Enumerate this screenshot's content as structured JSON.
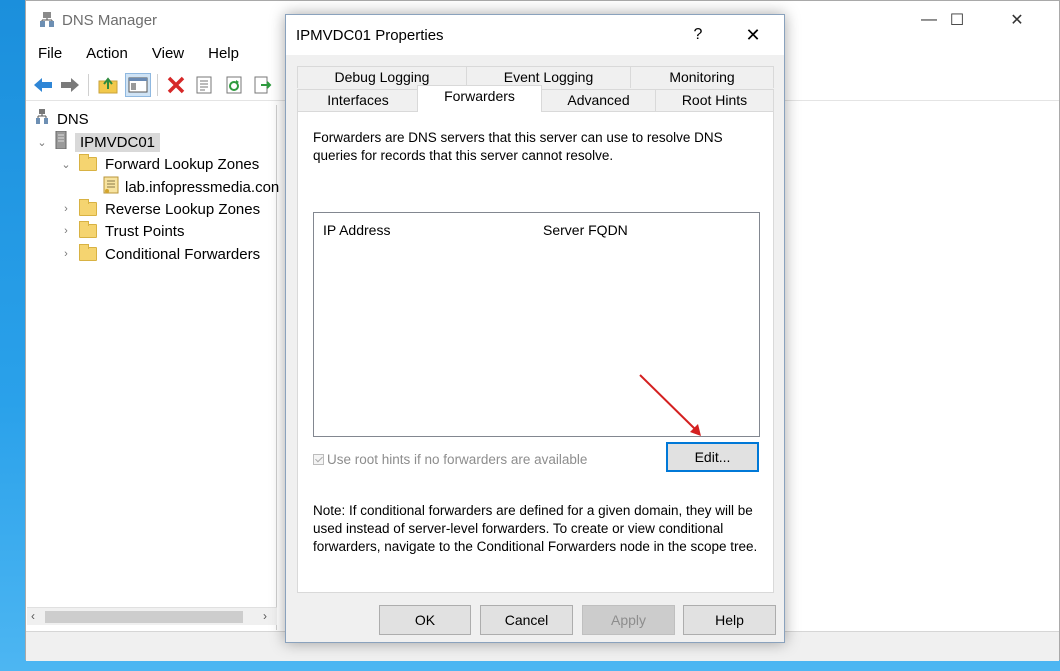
{
  "main_window": {
    "title": "DNS Manager",
    "controls": {
      "minimize": "—",
      "maximize": "☐",
      "close": "✕"
    }
  },
  "menu": [
    "File",
    "Action",
    "View",
    "Help"
  ],
  "toolbar_icons": [
    "back-icon",
    "forward-icon",
    "up-folder-icon",
    "show-hide-console-tree-icon",
    "delete-icon",
    "properties-icon",
    "refresh-icon",
    "export-list-icon"
  ],
  "tree": {
    "root": "DNS",
    "server": "IPMVDC01",
    "forward_lookup_zones": "Forward Lookup Zones",
    "zone": "lab.infopressmedia.con",
    "reverse_lookup_zones": "Reverse Lookup Zones",
    "trust_points": "Trust Points",
    "conditional_forwarders": "Conditional Forwarders"
  },
  "dialog": {
    "title": "IPMVDC01 Properties",
    "help_glyph": "?",
    "close_glyph": "✕",
    "tabs_top": [
      "Debug Logging",
      "Event Logging",
      "Monitoring"
    ],
    "tabs_bottom": [
      "Interfaces",
      "Forwarders",
      "Advanced",
      "Root Hints"
    ],
    "active_tab": "Forwarders",
    "description": "Forwarders are DNS servers that this server can use to resolve DNS queries for records that this server cannot resolve.",
    "list_columns": [
      "IP Address",
      "Server FQDN"
    ],
    "use_root_hints_label": "Use root hints if no forwarders are available",
    "use_root_hints_checked": true,
    "edit_button": "Edit...",
    "note": "Note: If conditional forwarders are defined for a given domain, they will be used instead of server-level forwarders.  To create or view conditional forwarders, navigate to the Conditional Forwarders node in the scope tree.",
    "buttons": {
      "ok": "OK",
      "cancel": "Cancel",
      "apply": "Apply",
      "help": "Help"
    }
  },
  "colors": {
    "desktop": "#1b8fdc",
    "annotation_arrow": "#d42020",
    "focus_border": "#0078d7"
  }
}
